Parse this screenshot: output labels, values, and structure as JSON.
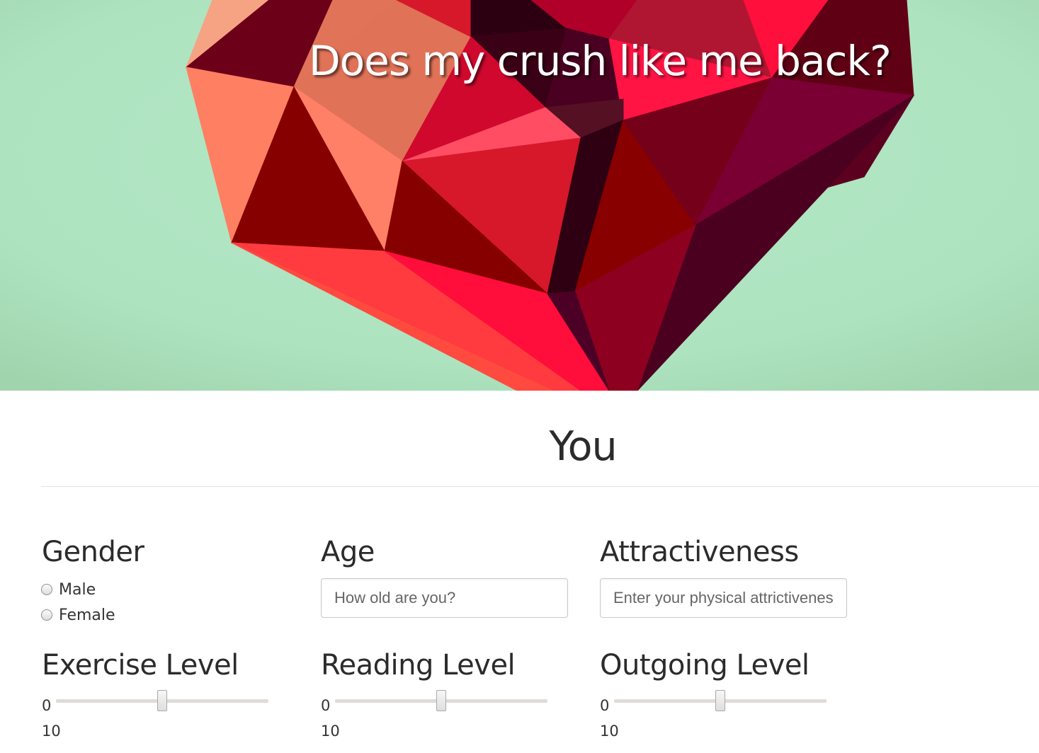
{
  "hero": {
    "title": "Does my crush like me back?"
  },
  "section": {
    "title": "You"
  },
  "gender": {
    "label": "Gender",
    "options": [
      "Male",
      "Female"
    ]
  },
  "age": {
    "label": "Age",
    "placeholder": "How old are you?"
  },
  "attractiveness": {
    "label": "Attractiveness",
    "placeholder": "Enter your physical attrictiveness"
  },
  "sliders": [
    {
      "label": "Exercise Level",
      "min": "0",
      "max": "10",
      "value_fraction": 0.5
    },
    {
      "label": "Reading Level",
      "min": "0",
      "max": "10",
      "value_fraction": 0.5
    },
    {
      "label": "Outgoing Level",
      "min": "0",
      "max": "10",
      "value_fraction": 0.5
    }
  ],
  "colors": {
    "background": "#afe4c0",
    "heart_dark": "#6e0019",
    "heart_bright": "#ff1040",
    "heart_coral": "#ff7f60"
  }
}
